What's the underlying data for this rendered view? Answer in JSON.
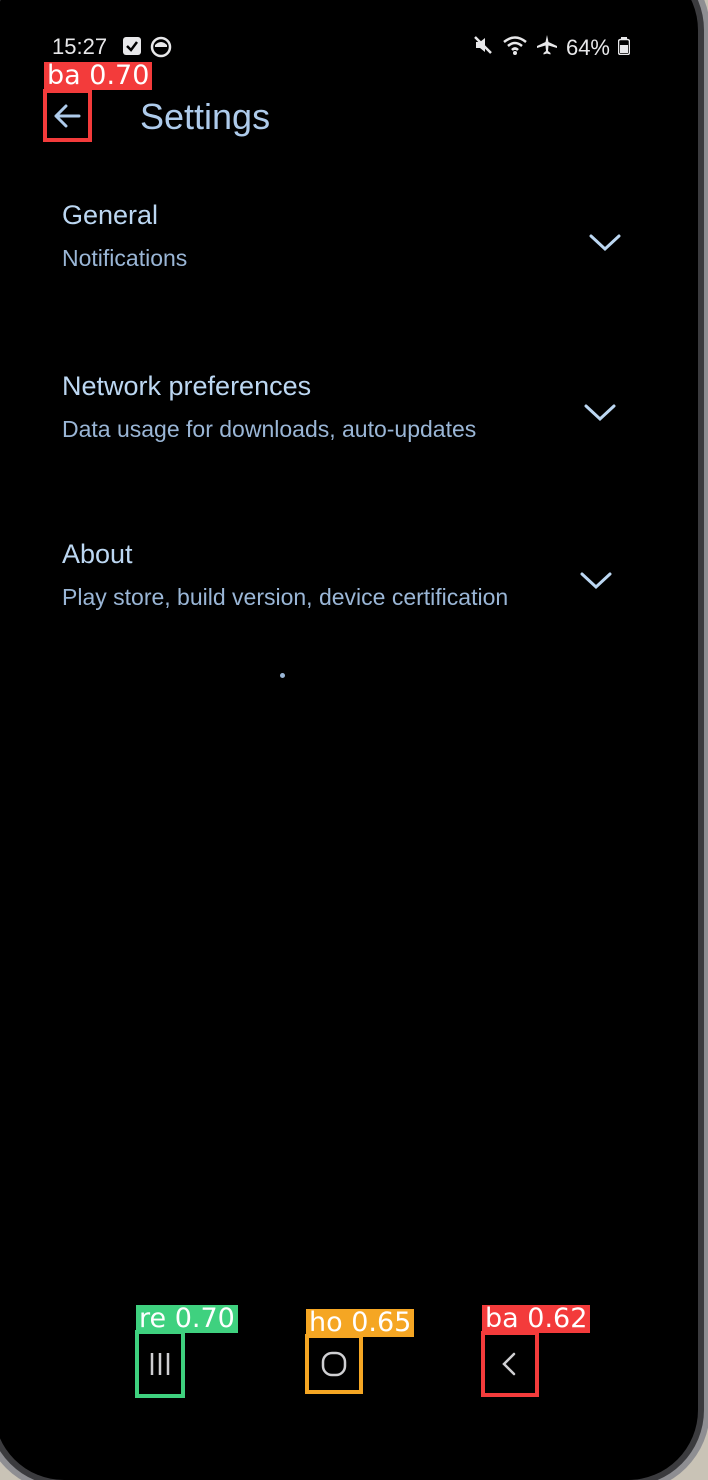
{
  "status_bar": {
    "time": "15:27",
    "battery": "64%",
    "icons": [
      "checkbox-icon",
      "circle-icon",
      "mute-icon",
      "wifi-icon",
      "airplane-icon",
      "battery-icon"
    ]
  },
  "app_bar": {
    "title": "Settings",
    "back_icon": "back-arrow-icon"
  },
  "settings": {
    "items": [
      {
        "label": "General",
        "sub": "Notifications"
      },
      {
        "label": "Network preferences",
        "sub": "Data usage for downloads, auto-updates"
      },
      {
        "label": "About",
        "sub": "Play store, build version, device certification"
      }
    ]
  },
  "annotations": [
    {
      "tag": "ba 0.70",
      "color": "#f33b3b"
    },
    {
      "tag": "re 0.70",
      "color": "#3fd17f"
    },
    {
      "tag": "ho 0.65",
      "color": "#f5a623"
    },
    {
      "tag": "ba 0.62",
      "color": "#f33b3b"
    }
  ],
  "nav_bar": {
    "items": [
      "recents-icon",
      "home-icon",
      "back-icon"
    ]
  },
  "colors": {
    "background": "#000000",
    "title": "#aecbeb",
    "label": "#bcd7f2",
    "sublabel": "#9ab6d6"
  }
}
